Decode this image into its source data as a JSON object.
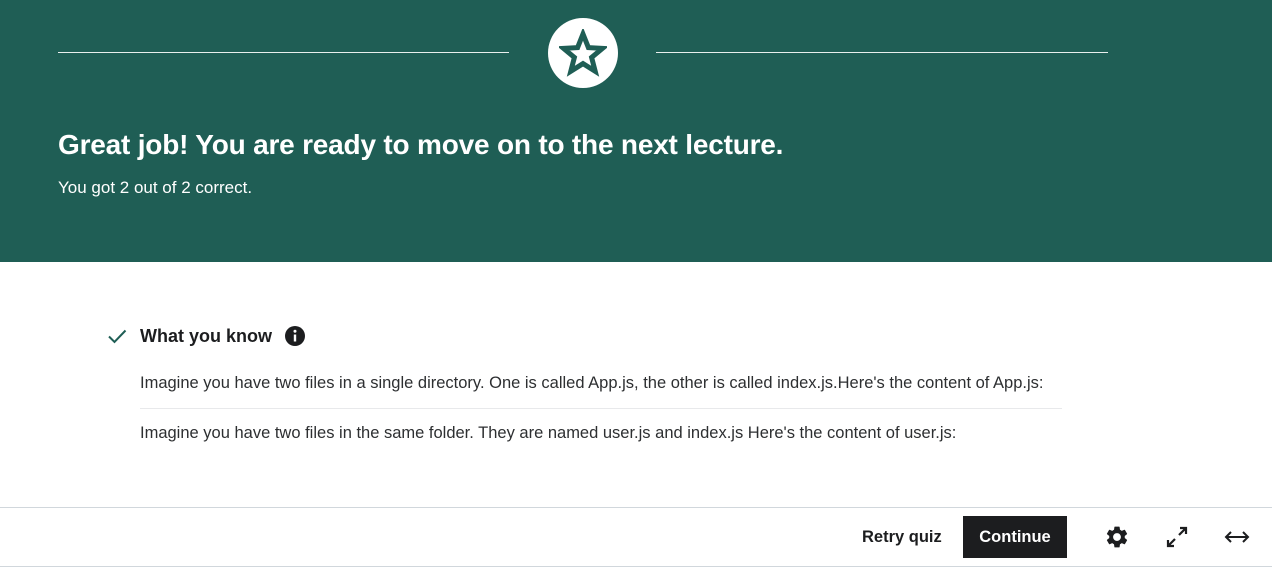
{
  "result": {
    "title": "Great job! You are ready to move on to the next lecture.",
    "score_text": "You got 2 out of 2 correct."
  },
  "knowledge": {
    "heading": "What you know",
    "items": [
      "Imagine you have two files in a single directory. One is called App.js, the other is called index.js.Here's the content of App.js:",
      "Imagine you have two files in the same folder.  They are named user.js and index.js Here's the content of user.js:"
    ]
  },
  "footer": {
    "retry_label": "Retry quiz",
    "continue_label": "Continue"
  },
  "icons": {
    "badge": "star-icon",
    "check": "check-icon",
    "info": "info-icon",
    "settings": "gear-icon",
    "fullscreen": "expand-icon",
    "wide": "arrows-horizontal-icon"
  },
  "colors": {
    "hero_bg": "#1f5e55",
    "check": "#1f5e55",
    "continue_bg": "#1c1d1f"
  }
}
